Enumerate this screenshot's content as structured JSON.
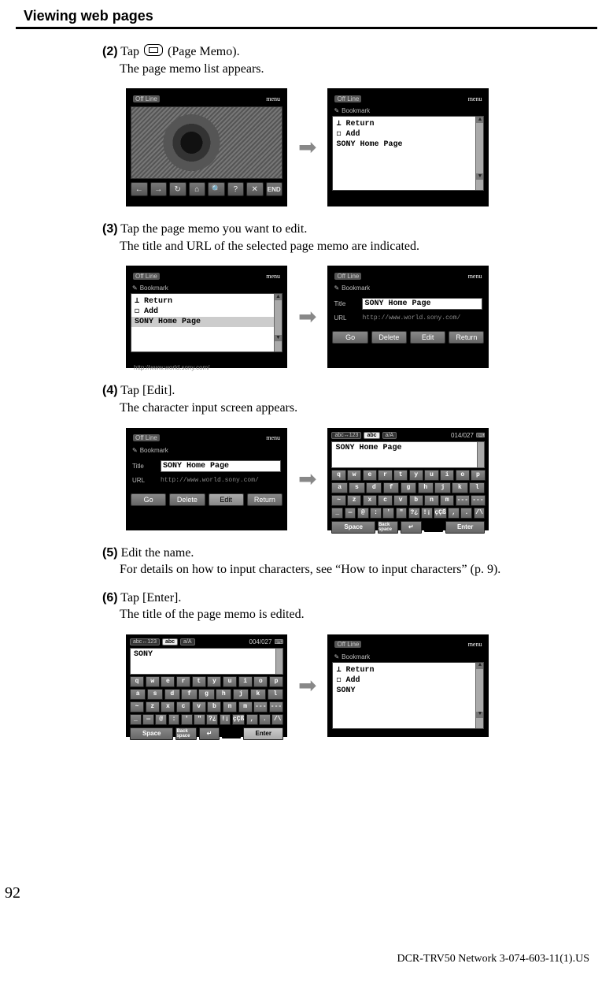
{
  "section_title": "Viewing web pages",
  "steps": {
    "s2": {
      "num": "(2)",
      "head": "Tap      (Page Memo).",
      "body": "The page memo list appears."
    },
    "s3": {
      "num": "(3)",
      "head": "Tap the page memo you want to edit.",
      "body": "The title and URL of the selected page memo are indicated."
    },
    "s4": {
      "num": "(4)",
      "head": "Tap [Edit].",
      "body": "The character input screen appears."
    },
    "s5": {
      "num": "(5)",
      "head": "Edit the name.",
      "body": "For details on how to input characters, see “How to input characters” (p.  9)."
    },
    "s6": {
      "num": "(6)",
      "head": "Tap [Enter].",
      "body": "The title of the page memo is edited."
    }
  },
  "shot": {
    "offline": "Off Line",
    "menu": "menu",
    "bookmark_tab": "Bookmark",
    "list": {
      "return": "⟂ Return",
      "add": "◻ Add",
      "sony": "SONY Home Page",
      "sony_short": "SONY"
    },
    "hint_url": "http://www.world.sony.com/",
    "title_label": "Title",
    "url_label": "URL",
    "buttons": {
      "go": "Go",
      "delete": "Delete",
      "edit": "Edit",
      "return": "Return"
    },
    "iconbar": {
      "back": "←",
      "fwd": "→",
      "reload": "↻",
      "home": "⌂",
      "search": "🔍",
      "help": "?",
      "close": "✕",
      "end": "END"
    }
  },
  "kbd": {
    "mode_seg": "abc↔123",
    "mode_abc": "abc",
    "mode_case": "a/A",
    "count1": "014/027",
    "count2": "004/027",
    "input1": "SONY Home Page",
    "input2": "SONY",
    "rows": {
      "r1": [
        "q",
        "w",
        "e",
        "r",
        "t",
        "y",
        "u",
        "i",
        "o",
        "p"
      ],
      "r2": [
        "a",
        "s",
        "d",
        "f",
        "g",
        "h",
        "j",
        "k",
        "l"
      ],
      "r3": [
        "~",
        "z",
        "x",
        "c",
        "v",
        "b",
        "n",
        "m",
        "---",
        "---"
      ],
      "r4": [
        "_",
        "—",
        "@",
        ":",
        "'",
        "\"",
        "?¿",
        "!¡",
        "çÇß",
        ",",
        ".",
        "/\\"
      ]
    },
    "bottom": {
      "space": "Space",
      "back": "Back\nspace",
      "newline": "↵",
      "enter": "Enter"
    }
  },
  "page_number": "92",
  "footer": "DCR-TRV50 Network 3-074-603-11(1).US"
}
